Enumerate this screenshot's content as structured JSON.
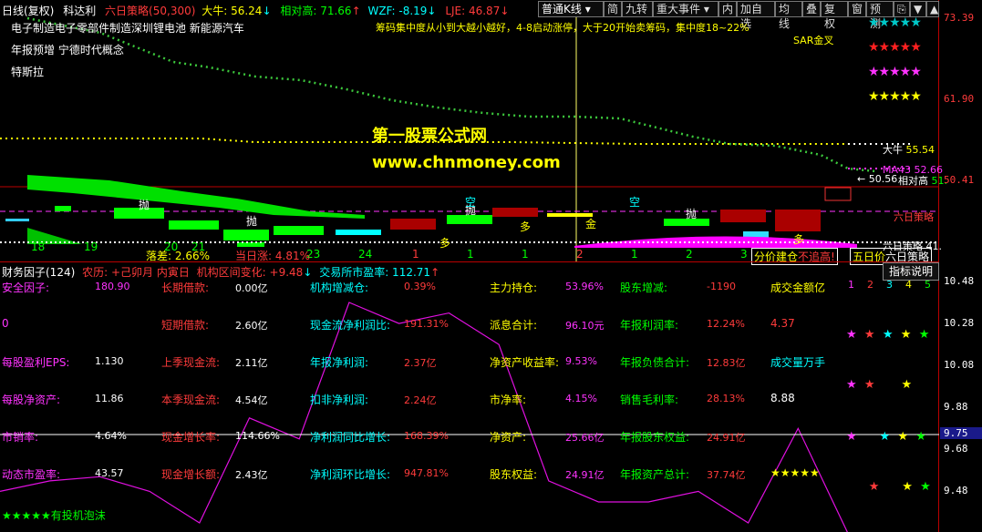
{
  "header": {
    "items": [
      {
        "text": "日线(复权)",
        "color": "#ffffff"
      },
      {
        "text": "科达利",
        "color": "#ffffff"
      },
      {
        "text": "六日策略(50,300)",
        "color": "#ff3b3b"
      },
      {
        "text": "大牛: 56.24",
        "color": "#ffff00"
      },
      {
        "text": "相对高: 71.66",
        "color": "#00ff00"
      },
      {
        "text": "WZF: -8.19",
        "color": "#00ffff"
      },
      {
        "text": "LJE: 46.87",
        "color": "#ff3b3b"
      }
    ],
    "arrows": [
      "↓",
      "↑",
      "↓",
      "↓"
    ]
  },
  "toolbar": {
    "kline": "普通K线",
    "simple": "简",
    "jiuzhuan": "九转",
    "major_events": "重大事件",
    "inner": "内",
    "add_watch": "加自选",
    "ma": "均线",
    "overlay": "叠",
    "rights": "复权",
    "window": "窗",
    "forecast": "预测"
  },
  "concepts": [
    "电子制造电子零部件制造深圳锂电池 新能源汽车",
    "年报预增 宁德时代概念",
    "特斯拉"
  ],
  "notice": "筹码集中度从小到大越小越好，4-8启动涨停，大于20开始卖筹码，集中度18~22%",
  "sar_label": "SAR金叉",
  "watermark": {
    "title": "第一股票公式网",
    "url": "www.chnmoney.com"
  },
  "price_axis": [
    "73.39",
    "61.90",
    "50.41"
  ],
  "right_labels": {
    "daniu": "大牛",
    "daniu_val": "55.54",
    "ma43": "MA43",
    "ma43_val": "52.66",
    "price_line": "← 50.56",
    "relative_high": "相对高",
    "rh_val": "51.",
    "zero_line": "六日策略",
    "zero_val": "41."
  },
  "chart_labels": {
    "pao1": "抛",
    "pao2": "抛",
    "pao3": "抛",
    "pao4": "抛",
    "kong1": "空",
    "kong2": "空",
    "duo1": "多",
    "duo2": "多",
    "duo3": "多",
    "jin": "金",
    "luocha": "落差:",
    "luocha_val": "2.66%",
    "dangri": "当日涨:",
    "dangri_val": "4.81%",
    "fenjia": "分价建仓",
    "buzhui": "不追高!",
    "wuri": "五日价",
    "lianri": "六日策略"
  },
  "counts": [
    "18",
    "19",
    "20",
    "21",
    "23",
    "24",
    "1",
    "1",
    "1",
    "2",
    "1",
    "2",
    "3"
  ],
  "lower_header": {
    "title": "财务因子(124)",
    "calendar": "农历: +己卯月 内寅日",
    "inst": "机构区间变化: +9.48",
    "pe": "交易所市盈率: 112.71",
    "button": "指标说明"
  },
  "fin_rows": [
    [
      {
        "l": "安全因子:",
        "v": "180.90",
        "lc": "#ff33ff",
        "vc": "#ff33ff"
      },
      {
        "l": "长期借款:",
        "v": "0.00亿",
        "lc": "#ff3b3b",
        "vc": "#ffffff"
      },
      {
        "l": "机构增减仓:",
        "v": "0.39%",
        "lc": "#00ffff",
        "vc": "#ff3b3b"
      },
      {
        "l": "主力持仓:",
        "v": "53.96%",
        "lc": "#ffff00",
        "vc": "#ff33ff"
      },
      {
        "l": "股东增减:",
        "v": "-1190",
        "lc": "#00ff00",
        "vc": "#ff3b3b"
      },
      {
        "l": "成交金额亿",
        "v": "",
        "lc": "#ffff00",
        "vc": "#ffff00"
      }
    ],
    [
      {
        "l": "0",
        "v": "",
        "lc": "#ff33ff",
        "vc": "#ff33ff"
      },
      {
        "l": "短期借款:",
        "v": "2.60亿",
        "lc": "#ff3b3b",
        "vc": "#ffffff"
      },
      {
        "l": "现金流净利润比:",
        "v": "191.31%",
        "lc": "#00ffff",
        "vc": "#ff3b3b"
      },
      {
        "l": "派息合计:",
        "v": "96.10元",
        "lc": "#ffff00",
        "vc": "#ff33ff"
      },
      {
        "l": "年报利润率:",
        "v": "12.24%",
        "lc": "#00ff00",
        "vc": "#ff3b3b"
      },
      {
        "l": "4.37",
        "v": "",
        "lc": "#ff3b3b",
        "vc": "#ff3b3b"
      }
    ],
    [
      {
        "l": "每股盈利EPS:",
        "v": "1.130",
        "lc": "#ff33ff",
        "vc": "#ffffff"
      },
      {
        "l": "上季现金流:",
        "v": "2.11亿",
        "lc": "#ff3b3b",
        "vc": "#ffffff"
      },
      {
        "l": "年报净利润:",
        "v": "2.37亿",
        "lc": "#00ffff",
        "vc": "#ff3b3b"
      },
      {
        "l": "净资产收益率:",
        "v": "9.53%",
        "lc": "#ffff00",
        "vc": "#ff33ff"
      },
      {
        "l": "年报负债合计:",
        "v": "12.83亿",
        "lc": "#00ff00",
        "vc": "#ff3b3b"
      },
      {
        "l": "成交量万手",
        "v": "",
        "lc": "#00ffff",
        "vc": "#00ffff"
      }
    ],
    [
      {
        "l": "每股净资产:",
        "v": "11.86",
        "lc": "#ff33ff",
        "vc": "#ffffff"
      },
      {
        "l": "本季现金流:",
        "v": "4.54亿",
        "lc": "#ff3b3b",
        "vc": "#ffffff"
      },
      {
        "l": "扣非净利润:",
        "v": "2.24亿",
        "lc": "#00ffff",
        "vc": "#ff3b3b"
      },
      {
        "l": "市净率:",
        "v": "4.15%",
        "lc": "#ffff00",
        "vc": "#ff33ff"
      },
      {
        "l": "销售毛利率:",
        "v": "28.13%",
        "lc": "#00ff00",
        "vc": "#ff3b3b"
      },
      {
        "l": "8.88",
        "v": "",
        "lc": "#ffffff",
        "vc": "#ffffff"
      }
    ],
    [
      {
        "l": "市销率:",
        "v": "4.64%",
        "lc": "#ff33ff",
        "vc": "#ffffff"
      },
      {
        "l": "现金增长率:",
        "v": "114.66%",
        "lc": "#ff3b3b",
        "vc": "#ffffff"
      },
      {
        "l": "净利润同比增长:",
        "v": "168.39%",
        "lc": "#00ffff",
        "vc": "#ff3b3b"
      },
      {
        "l": "净资产:",
        "v": "25.66亿",
        "lc": "#ffff00",
        "vc": "#ff33ff"
      },
      {
        "l": "年报股东权益:",
        "v": "24.91亿",
        "lc": "#00ff00",
        "vc": "#ff3b3b"
      },
      {
        "l": "",
        "v": "",
        "lc": "#fff",
        "vc": "#fff"
      }
    ],
    [
      {
        "l": "动态市盈率:",
        "v": "43.57",
        "lc": "#ff33ff",
        "vc": "#ffffff"
      },
      {
        "l": "现金增长额:",
        "v": "2.43亿",
        "lc": "#ff3b3b",
        "vc": "#ffffff"
      },
      {
        "l": "净利润环比增长:",
        "v": "947.81%",
        "lc": "#00ffff",
        "vc": "#ff3b3b"
      },
      {
        "l": "股东权益:",
        "v": "24.91亿",
        "lc": "#ffff00",
        "vc": "#ff33ff"
      },
      {
        "l": "年报资产总计:",
        "v": "37.74亿",
        "lc": "#00ff00",
        "vc": "#ff3b3b"
      },
      {
        "l": "★★★★★",
        "v": "",
        "lc": "#ffff00",
        "vc": "#ffff00"
      }
    ]
  ],
  "rank_numbers": [
    "1",
    "2",
    "3",
    "4",
    "5"
  ],
  "bottom_label": "★★★★★有投机泡沫",
  "lower_axis": [
    "10.48",
    "10.28",
    "10.08",
    "9.88",
    "9.75",
    "9.68",
    "9.48"
  ],
  "colors": {
    "accent_red": "#ff3b3b",
    "yellow": "#ffff00",
    "green": "#00ff00",
    "cyan": "#00ffff",
    "magenta": "#ff33ff"
  },
  "chart_data": [
    {
      "type": "line",
      "title": "",
      "note": "upper price panel with indicator lines",
      "ylim": [
        41,
        73.39
      ],
      "yticks": [
        73.39,
        61.9,
        50.41
      ],
      "series": [
        {
          "name": "大牛",
          "last": 55.54
        },
        {
          "name": "MA43",
          "last": 52.66
        }
      ]
    },
    {
      "type": "line",
      "title": "",
      "ylim": [
        9.4,
        10.55
      ],
      "yticks": [
        10.48,
        10.28,
        10.08,
        9.88,
        9.68,
        9.48
      ],
      "series": [
        {
          "name": "",
          "values": [
            9.55,
            9.6,
            9.62,
            9.55,
            9.4,
            9.9,
            9.8,
            10.45,
            10.35,
            10.4,
            10.25,
            9.6,
            9.5,
            9.5,
            9.55,
            9.4,
            9.85,
            9.35
          ]
        }
      ]
    }
  ]
}
